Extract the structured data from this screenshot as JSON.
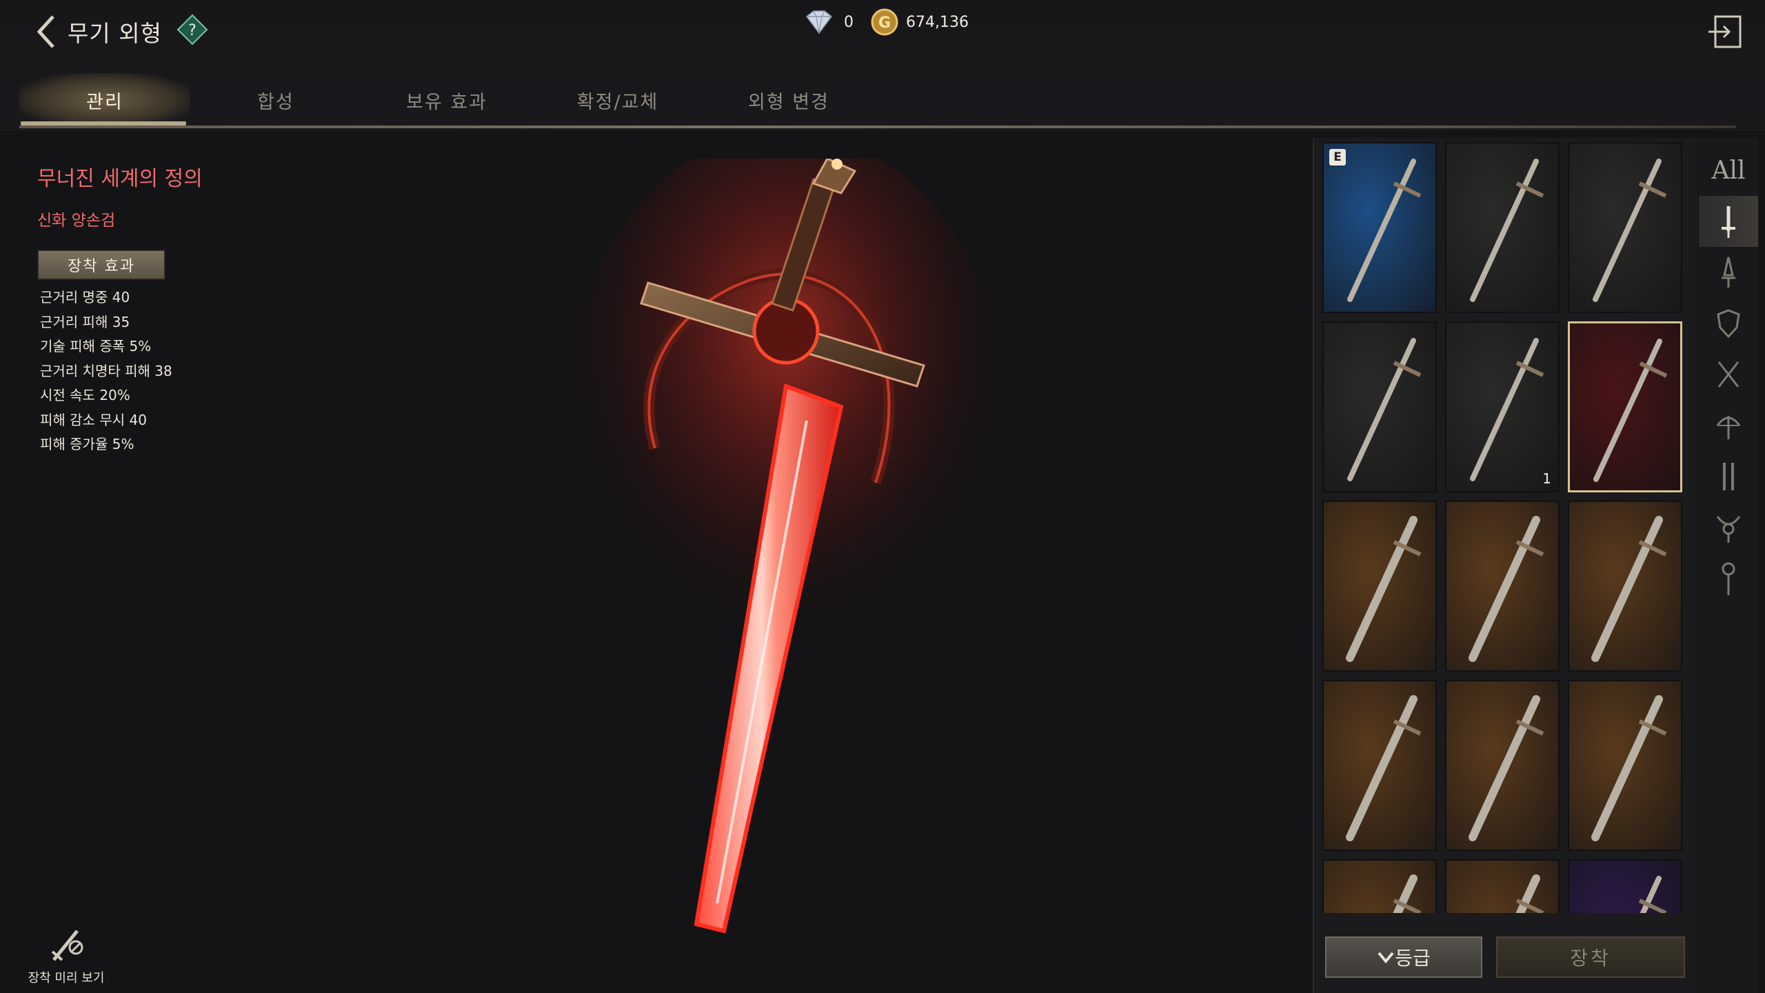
{
  "header": {
    "title": "무기 외형",
    "diamond_amount": "0",
    "gold_amount": "674,136",
    "icons": {
      "back": "chevron-left-icon",
      "help": "question-diamond-icon",
      "diamond": "diamond-icon",
      "gold": "gold-coin-icon",
      "exit": "exit-icon"
    }
  },
  "tabs": [
    "관리",
    "합성",
    "보유 효과",
    "확정/교체",
    "외형 변경"
  ],
  "active_tab": "관리",
  "weapon": {
    "name": "무너진 세계의 정의",
    "grade": "신화 양손검",
    "equip_effect_label": "장착 효과",
    "stats": [
      "근거리 명중 40",
      "근거리 피해 35",
      "기술 피해 증폭 5%",
      "근거리 치명타 피해 38",
      "시전 속도 20%",
      "피해 감소 무시 40",
      "피해 증가율 5%"
    ]
  },
  "preview": {
    "label": "장착 미리 보기"
  },
  "grid": {
    "equipped_badge": "E",
    "count_label": "1",
    "cells": [
      {
        "tier": "rare",
        "bg": "#1d4e86"
      },
      {
        "tier": "common",
        "bg": "#2a2a29"
      },
      {
        "tier": "common",
        "bg": "#2a2a29"
      },
      {
        "tier": "common",
        "bg": "#2a2a29"
      },
      {
        "tier": "common",
        "bg": "#2a2a29"
      },
      {
        "tier": "mythic",
        "bg": "#4a1417"
      },
      {
        "tier": "epic",
        "bg": "#5a3a1c"
      },
      {
        "tier": "epic",
        "bg": "#5a3a1c"
      },
      {
        "tier": "epic",
        "bg": "#5a3a1c"
      },
      {
        "tier": "epic",
        "bg": "#5a3a1c"
      },
      {
        "tier": "epic",
        "bg": "#5a3a1c"
      },
      {
        "tier": "epic",
        "bg": "#5a3a1c"
      },
      {
        "tier": "epic",
        "bg": "#5a3a1c"
      },
      {
        "tier": "epic",
        "bg": "#5a3a1c"
      },
      {
        "tier": "legend",
        "bg": "#2c1a48"
      }
    ]
  },
  "buttons": {
    "grade": "등급",
    "equip": "장착"
  },
  "filters": {
    "all_label": "All",
    "icons": [
      "sword-icon",
      "dagger-icon",
      "shield-icon",
      "crossed-swords-icon",
      "bow-icon",
      "dual-blades-icon",
      "orb-icon",
      "staff-icon"
    ]
  }
}
